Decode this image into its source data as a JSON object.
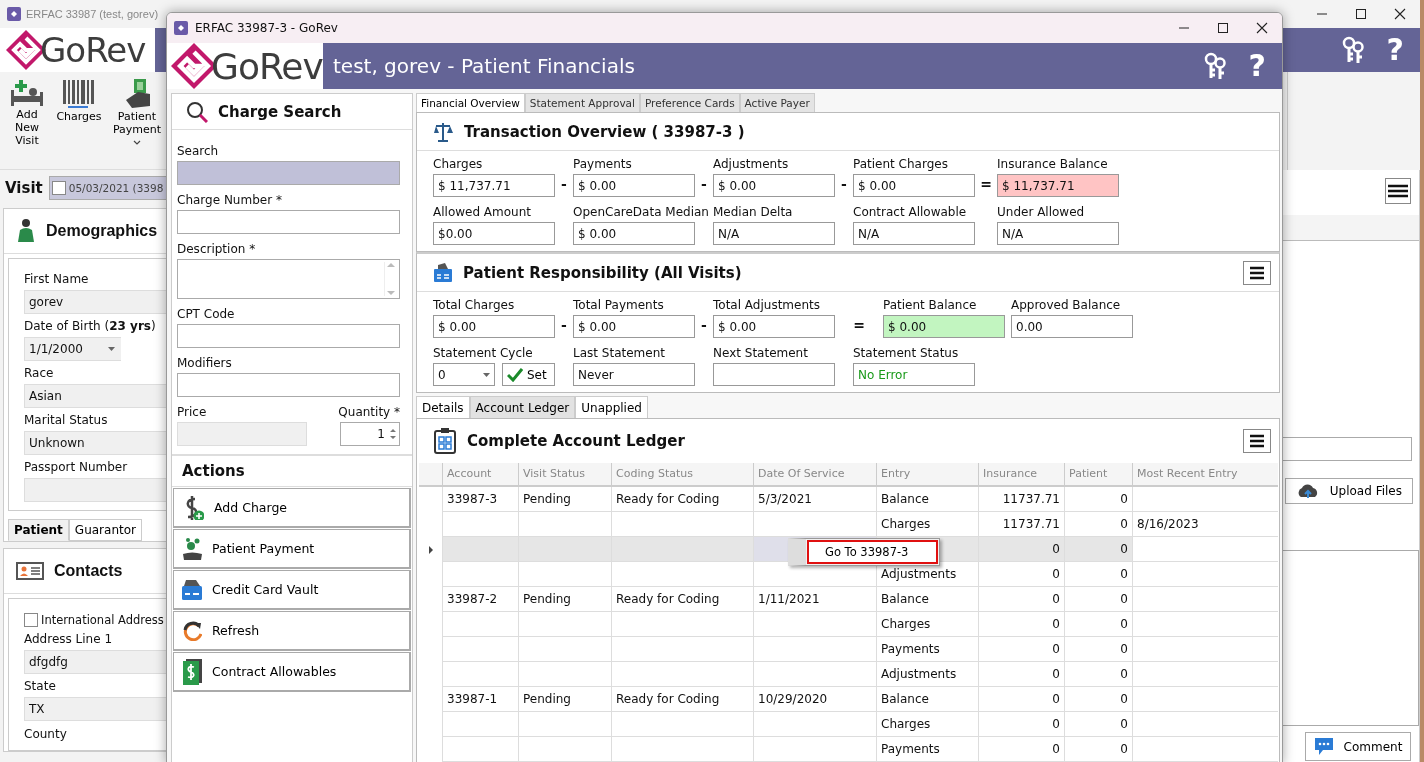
{
  "background_window": {
    "title": "ERFAC 33987 (test, gorev)",
    "logo": "GoRev",
    "help": "?",
    "toolbar": [
      {
        "label": "Add New Visit",
        "kind": "button"
      },
      {
        "label": "Charges",
        "kind": "button"
      },
      {
        "label": "Patient Payment",
        "kind": "menu"
      }
    ],
    "visit": {
      "label": "Visit",
      "checked": false,
      "value": "05/03/2021 (3398"
    },
    "demographics": {
      "title": "Demographics",
      "fields": [
        {
          "label": "First Name",
          "value": "gorev",
          "kind": "text"
        },
        {
          "label": "Date of Birth (**23 yrs**)",
          "value": "1/1/2000",
          "kind": "date"
        },
        {
          "label": "Race",
          "value": "Asian",
          "kind": "text"
        },
        {
          "label": "Marital Status",
          "value": "Unknown",
          "kind": "select"
        },
        {
          "label": "Passport Number",
          "kind": "text"
        }
      ],
      "tabs": [
        {
          "label": "Patient",
          "selected": true
        },
        {
          "label": "Guarantor",
          "selected": false
        }
      ]
    },
    "contacts": {
      "title": "Contacts",
      "international_address": {
        "label": "International Address",
        "checked": false
      },
      "fields": [
        {
          "label": "Address Line 1",
          "value": "dfgdfg",
          "kind": "text"
        },
        {
          "label": "State",
          "value": "TX",
          "kind": "text"
        },
        {
          "label": "County",
          "kind": "cut"
        }
      ]
    },
    "side_buttons": {
      "upload": "Upload Files",
      "comment": "Comment"
    }
  },
  "window": {
    "title": "ERFAC 33987-3 - GoRev",
    "logo": "GoRev",
    "header": "test, gorev - Patient Financials",
    "help": "?"
  },
  "charge_search": {
    "title": "Charge Search",
    "fields": [
      {
        "label": "Search",
        "kind": "search"
      },
      {
        "label": "Charge Number *",
        "kind": "text"
      },
      {
        "label": "Description *",
        "kind": "textarea"
      },
      {
        "label": "CPT Code",
        "kind": "text"
      },
      {
        "label": "Modifiers",
        "kind": "text"
      }
    ],
    "price": {
      "label": "Price"
    },
    "quantity": {
      "label": "Quantity *",
      "value": "1"
    }
  },
  "actions": {
    "title": "Actions",
    "items": [
      {
        "label": "Add Charge"
      },
      {
        "label": "Patient Payment"
      },
      {
        "label": "Credit Card Vault"
      },
      {
        "label": "Refresh"
      },
      {
        "label": "Contract Allowables"
      }
    ]
  },
  "tabs": [
    {
      "label": "Financial Overview",
      "selected": true
    },
    {
      "label": "Statement Approval",
      "selected": false
    },
    {
      "label": "Preference Cards",
      "selected": false
    },
    {
      "label": "Active Payer",
      "selected": false
    }
  ],
  "transaction_overview": {
    "title": "Transaction Overview ( 33987-3 )",
    "rows": [
      [
        {
          "label": "Charges",
          "value": "$ 11,737.71",
          "operator": "-"
        },
        {
          "label": "Payments",
          "value": "$ 0.00",
          "operator": "-"
        },
        {
          "label": "Adjustments",
          "value": "$ 0.00",
          "operator": "-"
        },
        {
          "label": "Patient Charges",
          "value": "$ 0.00",
          "operator": "="
        },
        {
          "label": "Insurance Balance",
          "value": "$ 11,737.71",
          "color": "#ffc4c4"
        }
      ],
      [
        {
          "label": "Allowed Amount",
          "value": "$0.00"
        },
        {
          "label": "OpenCareData Median",
          "value": "$ 0.00"
        },
        {
          "label": "Median Delta",
          "value": "N/A"
        },
        {
          "label": "Contract Allowable",
          "value": "N/A"
        },
        {
          "label": "Under Allowed",
          "value": "N/A"
        }
      ]
    ]
  },
  "patient_responsibility": {
    "title": "Patient Responsibility (All Visits)",
    "totals": [
      {
        "label": "Total Charges",
        "value": "$ 0.00",
        "operator": "-"
      },
      {
        "label": "Total Payments",
        "value": "$ 0.00",
        "operator": "-"
      },
      {
        "label": "Total Adjustments",
        "value": "$ 0.00",
        "operator": "="
      },
      {
        "label": "Patient Balance",
        "value": "$ 0.00",
        "color": "#c2f5c0"
      },
      {
        "label": "Approved Balance",
        "value": "0.00"
      }
    ],
    "statement": [
      {
        "label": "Statement Cycle",
        "value": "0",
        "kind": "cycle",
        "button": "Set"
      },
      {
        "label": "Last Statement",
        "value": "Never",
        "kind": "text"
      },
      {
        "label": "Next Statement",
        "kind": "text"
      },
      {
        "label": "Statement Status",
        "value": "No Error",
        "kind": "status",
        "color": "#1a9a1a"
      }
    ]
  },
  "ledger_tabs": [
    {
      "label": "Details",
      "selected": false
    },
    {
      "label": "Account Ledger",
      "selected": true
    },
    {
      "label": "Unapplied",
      "selected": false
    }
  ],
  "ledger": {
    "title": "Complete Account Ledger",
    "columns": [
      "Account",
      "Visit Status",
      "Coding Status",
      "Date Of Service",
      "Entry",
      "Insurance",
      "Patient",
      "Most Recent Entry"
    ],
    "rows": [
      {
        "selected": false,
        "cells": {
          "account": "33987-3",
          "visit_status": "Pending",
          "coding_status": "Ready for Coding",
          "date_of_service": "5/3/2021",
          "entry": "Balance",
          "insurance": "11737.71",
          "patient": "0"
        }
      },
      {
        "selected": false,
        "cells": {
          "entry": "Charges",
          "insurance": "11737.71",
          "patient": "0",
          "most_recent_entry": "8/16/2023"
        }
      },
      {
        "selected": true,
        "cells": {
          "insurance": "0",
          "patient": "0"
        }
      },
      {
        "selected": false,
        "cells": {
          "entry": "Adjustments",
          "insurance": "0",
          "patient": "0"
        }
      },
      {
        "selected": false,
        "cells": {
          "account": "33987-2",
          "visit_status": "Pending",
          "coding_status": "Ready for Coding",
          "date_of_service": "1/11/2021",
          "entry": "Balance",
          "insurance": "0",
          "patient": "0"
        }
      },
      {
        "selected": false,
        "cells": {
          "entry": "Charges",
          "insurance": "0",
          "patient": "0"
        }
      },
      {
        "selected": false,
        "cells": {
          "entry": "Payments",
          "insurance": "0",
          "patient": "0"
        }
      },
      {
        "selected": false,
        "cells": {
          "entry": "Adjustments",
          "insurance": "0",
          "patient": "0"
        }
      },
      {
        "selected": false,
        "cells": {
          "account": "33987-1",
          "visit_status": "Pending",
          "coding_status": "Ready for Coding",
          "date_of_service": "10/29/2020",
          "entry": "Balance",
          "insurance": "0",
          "patient": "0"
        }
      },
      {
        "selected": false,
        "cells": {
          "entry": "Charges",
          "insurance": "0",
          "patient": "0"
        }
      },
      {
        "selected": false,
        "cells": {
          "entry": "Payments",
          "insurance": "0",
          "patient": "0"
        }
      }
    ],
    "context_menu": {
      "items": [
        {
          "label": "Go To 33987-3",
          "highlighted": true
        }
      ]
    }
  }
}
